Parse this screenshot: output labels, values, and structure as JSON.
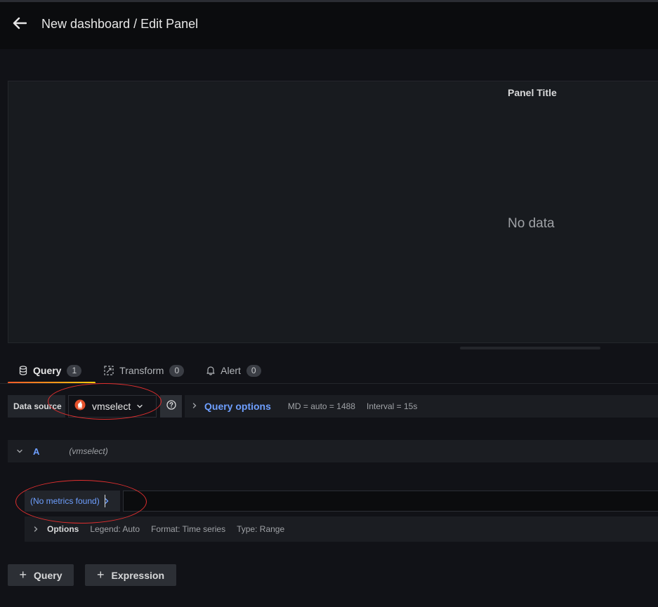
{
  "header": {
    "title": "New dashboard / Edit Panel",
    "back_icon": "arrow-left-icon"
  },
  "panel": {
    "title": "Panel Title",
    "empty_message": "No data"
  },
  "tabs": [
    {
      "label": "Query",
      "count": "1",
      "icon": "database-icon",
      "active": true
    },
    {
      "label": "Transform",
      "count": "0",
      "icon": "transform-icon",
      "active": false
    },
    {
      "label": "Alert",
      "count": "0",
      "icon": "bell-icon",
      "active": false
    }
  ],
  "datasource": {
    "label": "Data source",
    "selected": "vmselect",
    "help_icon": "question-circle-icon",
    "query_options_label": "Query options",
    "md": "MD = auto = 1488",
    "interval": "Interval = 15s"
  },
  "query": {
    "ref_id": "A",
    "datasource": "(vmselect)",
    "metrics_button": "(No metrics found)",
    "input_value": "",
    "options_label": "Options",
    "legend": "Legend: Auto",
    "format": "Format: Time series",
    "type": "Type: Range"
  },
  "actions": {
    "add_query": "Query",
    "add_expression": "Expression"
  },
  "colors": {
    "accent_blue": "#6e9fff",
    "tab_underline_start": "#f05a28",
    "tab_underline_end": "#fbca0a",
    "annotation_red": "#e02f2f",
    "prometheus_red": "#e6522c"
  }
}
